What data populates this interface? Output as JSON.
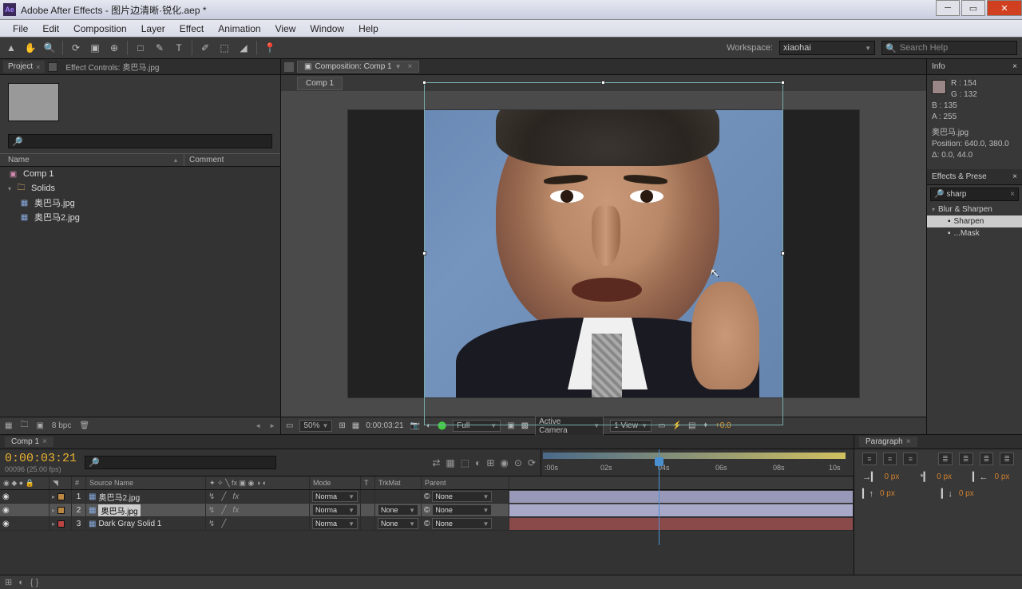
{
  "title": "Adobe After Effects - 图片边清晰·锐化.aep *",
  "menu": [
    "File",
    "Edit",
    "Composition",
    "Layer",
    "Effect",
    "Animation",
    "View",
    "Window",
    "Help"
  ],
  "workspace": {
    "label": "Workspace:",
    "value": "xiaohai"
  },
  "searchHelp": "Search Help",
  "projectPanel": {
    "tab": "Project",
    "effectControls": "Effect Controls: 奥巴马.jpg",
    "headers": {
      "name": "Name",
      "comment": "Comment"
    },
    "items": [
      {
        "icon": "▣",
        "label": "Comp 1"
      },
      {
        "icon": "▸",
        "label": "Solids",
        "indent": 0,
        "folder": true
      },
      {
        "icon": "▦",
        "label": "奥巴马.jpg",
        "indent": 1
      },
      {
        "icon": "▦",
        "label": "奥巴马2.jpg",
        "indent": 1
      }
    ],
    "footer": {
      "bpc": "8 bpc"
    }
  },
  "compPanel": {
    "tab": "Composition: Comp 1",
    "subtab": "Comp 1",
    "footer": {
      "zoom": "50%",
      "time": "0:00:03:21",
      "res": "Full",
      "camera": "Active Camera",
      "view": "1 View",
      "exposure": "+0.0"
    }
  },
  "info": {
    "title": "Info",
    "r": "R : 154",
    "g": "G : 132",
    "b": "B : 135",
    "a": "A : 255",
    "name": "奥巴马.jpg",
    "pos": "Position: 640.0, 380.0",
    "delta": "Δ: 0.0, 44.0"
  },
  "effects": {
    "title": "Effects & Prese",
    "search": "sharp",
    "category": "Blur & Sharpen",
    "items": [
      {
        "label": "Sharpen",
        "sel": true
      },
      {
        "label": "...Mask",
        "sel": false
      }
    ]
  },
  "timeline": {
    "tab": "Comp 1",
    "timecode": "0:00:03:21",
    "fps": "00096 (25.00 fps)",
    "cols": {
      "num": "#",
      "source": "Source Name",
      "mode": "Mode",
      "trkmat": "TrkMat",
      "parent": "Parent",
      "t": "T"
    },
    "ticks": [
      ":00s",
      "02s",
      "04s",
      "06s",
      "08s",
      "10s"
    ],
    "layers": [
      {
        "num": "1",
        "color": "#b84",
        "name": "奥巴马2.jpg",
        "mode": "Norma",
        "trkmat": "",
        "parent": "None",
        "barClass": "bar1"
      },
      {
        "num": "2",
        "color": "#b84",
        "name": "奥巴马.jpg",
        "mode": "Norma",
        "trkmat": "None",
        "parent": "None",
        "barClass": "bar2",
        "sel": true
      },
      {
        "num": "3",
        "color": "#b44",
        "name": "Dark Gray Solid 1",
        "mode": "Norma",
        "trkmat": "None",
        "parent": "None",
        "barClass": "bar3"
      }
    ]
  },
  "paragraph": {
    "title": "Paragraph",
    "px": "0 px"
  }
}
